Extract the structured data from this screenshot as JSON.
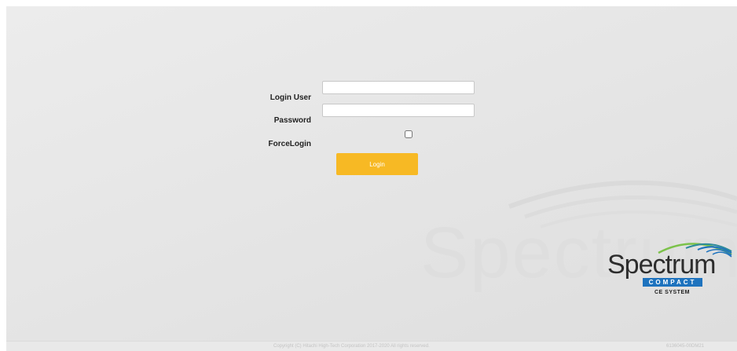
{
  "login_form": {
    "user_label": "Login User",
    "user_value": "",
    "password_label": "Password",
    "password_value": "",
    "force_login_label": "ForceLogin",
    "force_login_checked": false,
    "login_button_label": "Login"
  },
  "branding": {
    "watermark_text": "Spectrum",
    "logo_word": "Spectrum",
    "logo_sub": "COMPACT",
    "logo_system": "CE SYSTEM"
  },
  "footer": {
    "copyright": "Copyright (C) Hitachi High-Tech Corporation 2017-2020 All rights reserved.",
    "version": "6136045-00DM21"
  },
  "colors": {
    "accent_button": "#f7b924",
    "logo_blue": "#1e73be",
    "logo_arc_green": "#7cc24a"
  }
}
